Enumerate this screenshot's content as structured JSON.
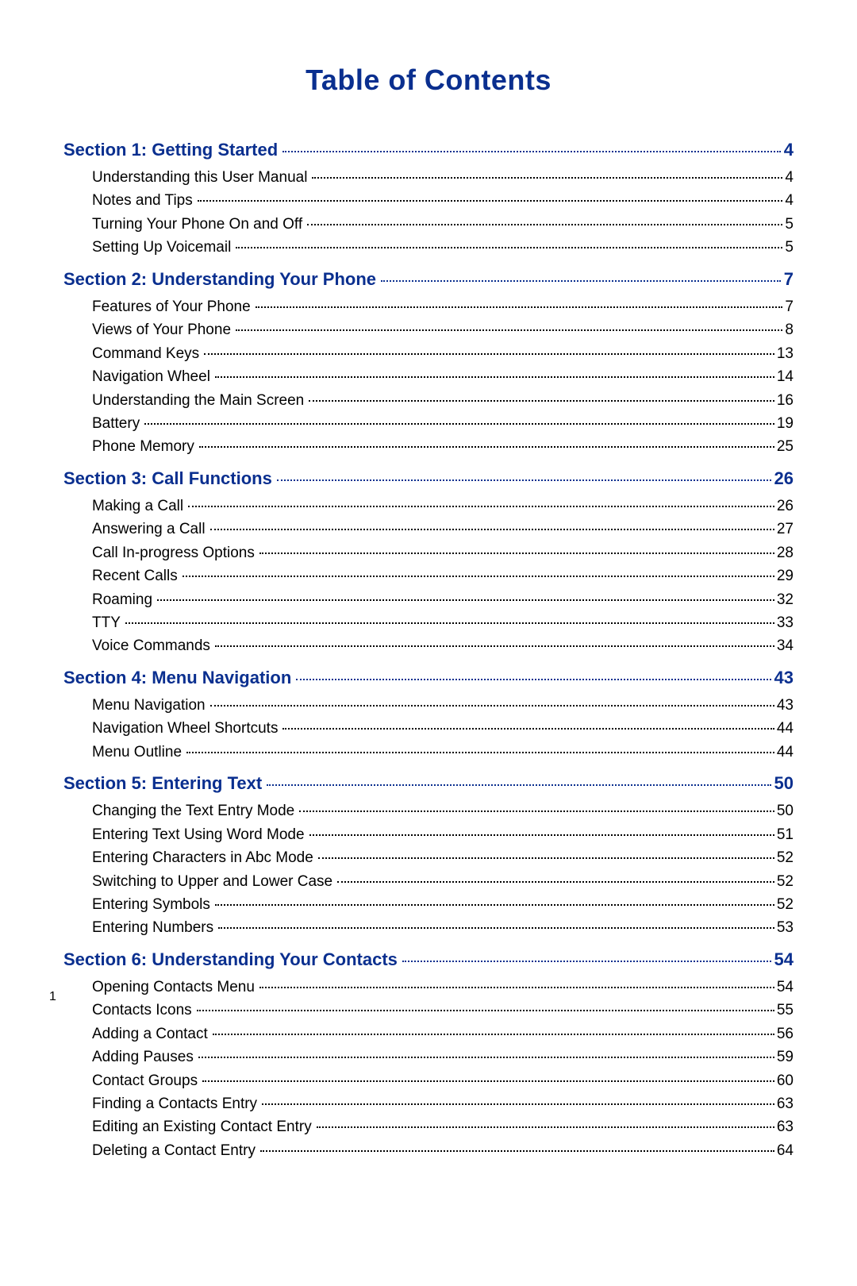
{
  "title": "Table of Contents",
  "page_number": "1",
  "sections": [
    {
      "label": "Section 1:  Getting Started",
      "page": "4",
      "items": [
        {
          "label": "Understanding this User Manual",
          "page": "4"
        },
        {
          "label": "Notes and Tips",
          "page": "4"
        },
        {
          "label": "Turning Your Phone On and Off",
          "page": "5"
        },
        {
          "label": "Setting Up Voicemail",
          "page": "5"
        }
      ]
    },
    {
      "label": "Section 2:  Understanding Your Phone",
      "page": "7",
      "items": [
        {
          "label": "Features of Your Phone",
          "page": "7"
        },
        {
          "label": "Views of Your Phone",
          "page": "8"
        },
        {
          "label": "Command Keys",
          "page": "13"
        },
        {
          "label": "Navigation Wheel",
          "page": "14"
        },
        {
          "label": "Understanding the Main Screen",
          "page": "16"
        },
        {
          "label": "Battery",
          "page": "19"
        },
        {
          "label": "Phone Memory",
          "page": "25"
        }
      ]
    },
    {
      "label": "Section 3:  Call Functions",
      "page": "26",
      "items": [
        {
          "label": "Making a Call",
          "page": "26"
        },
        {
          "label": "Answering a Call",
          "page": "27"
        },
        {
          "label": "Call In-progress Options",
          "page": "28"
        },
        {
          "label": "Recent Calls",
          "page": "29"
        },
        {
          "label": "Roaming",
          "page": "32"
        },
        {
          "label": "TTY",
          "page": "33"
        },
        {
          "label": "Voice Commands",
          "page": "34"
        }
      ]
    },
    {
      "label": "Section 4:  Menu Navigation",
      "page": "43",
      "items": [
        {
          "label": "Menu Navigation",
          "page": "43"
        },
        {
          "label": "Navigation Wheel Shortcuts",
          "page": "44"
        },
        {
          "label": "Menu Outline",
          "page": "44"
        }
      ]
    },
    {
      "label": "Section 5:  Entering Text",
      "page": "50",
      "items": [
        {
          "label": "Changing the Text Entry Mode",
          "page": "50"
        },
        {
          "label": "Entering Text Using Word Mode",
          "page": "51"
        },
        {
          "label": "Entering Characters in Abc Mode",
          "page": "52"
        },
        {
          "label": "Switching to Upper and Lower Case",
          "page": "52"
        },
        {
          "label": "Entering Symbols",
          "page": "52"
        },
        {
          "label": "Entering Numbers",
          "page": "53"
        }
      ]
    },
    {
      "label": "Section 6:  Understanding Your Contacts",
      "page": "54",
      "items": [
        {
          "label": "Opening Contacts Menu",
          "page": "54"
        },
        {
          "label": "Contacts Icons",
          "page": "55"
        },
        {
          "label": "Adding a Contact",
          "page": "56"
        },
        {
          "label": "Adding Pauses",
          "page": "59"
        },
        {
          "label": "Contact Groups",
          "page": "60"
        },
        {
          "label": "Finding a Contacts Entry",
          "page": "63"
        },
        {
          "label": "Editing an Existing Contact Entry",
          "page": "63"
        },
        {
          "label": "Deleting a Contact Entry",
          "page": "64"
        }
      ]
    }
  ]
}
